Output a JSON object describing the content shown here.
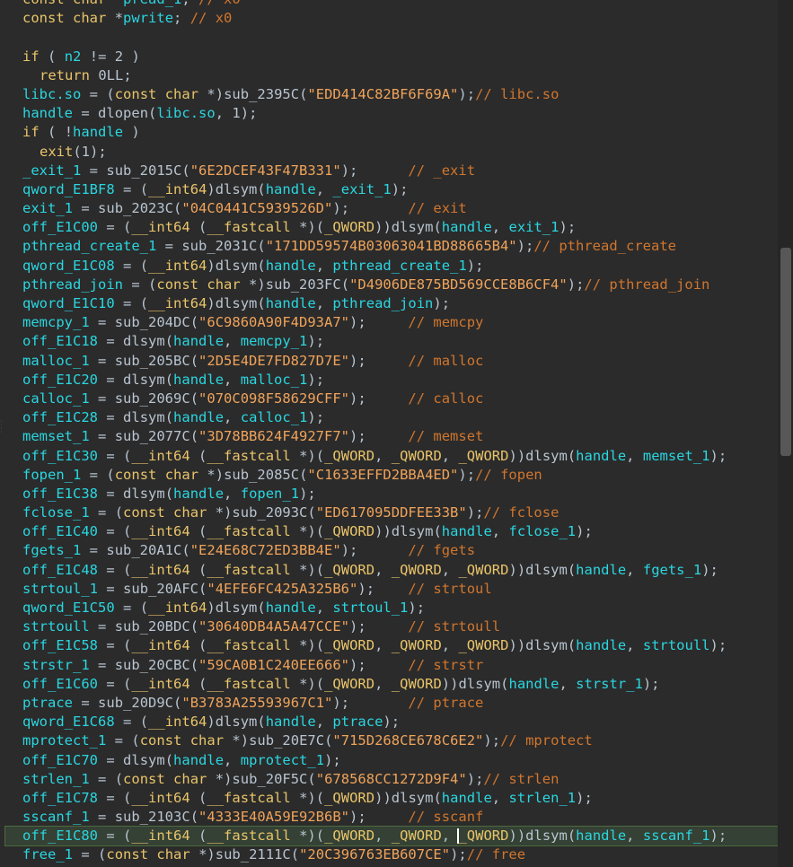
{
  "editor": {
    "lines": [
      "const char *pread_1; // x0",
      "const char *pwrite; // x0",
      "",
      "if ( n2 != 2 )",
      "  return 0LL;",
      "libc.so = (const char *)sub_2395C(\"EDD414C82BF6F69A\");// libc.so",
      "handle = dlopen(libc.so, 1);",
      "if ( !handle )",
      "  exit(1);",
      "_exit_1 = sub_2015C(\"6E2DCEF43F47B331\");      // _exit",
      "qword_E1BF8 = (__int64)dlsym(handle, _exit_1);",
      "exit_1 = sub_2023C(\"04C0441C5939526D\");       // exit",
      "off_E1C00 = (__int64 (__fastcall *)(_QWORD))dlsym(handle, exit_1);",
      "pthread_create_1 = sub_2031C(\"171DD59574B03063041BD88665B4\");// pthread_create",
      "qword_E1C08 = (__int64)dlsym(handle, pthread_create_1);",
      "pthread_join = (const char *)sub_203FC(\"D4906DE875BD569CCE8B6CF4\");// pthread_join",
      "qword_E1C10 = (__int64)dlsym(handle, pthread_join);",
      "memcpy_1 = sub_204DC(\"6C9860A90F4D93A7\");     // memcpy",
      "off_E1C18 = dlsym(handle, memcpy_1);",
      "malloc_1 = sub_205BC(\"2D5E4DE7FD827D7E\");     // malloc",
      "off_E1C20 = dlsym(handle, malloc_1);",
      "calloc_1 = sub_2069C(\"070C098F58629CFF\");     // calloc",
      "off_E1C28 = dlsym(handle, calloc_1);",
      "memset_1 = sub_2077C(\"3D78BB624F4927F7\");     // memset",
      "off_E1C30 = (__int64 (__fastcall *)(_QWORD, _QWORD, _QWORD))dlsym(handle, memset_1);",
      "fopen_1 = (const char *)sub_2085C(\"C1633EFFD2BBA4ED\");// fopen",
      "off_E1C38 = dlsym(handle, fopen_1);",
      "fclose_1 = (const char *)sub_2093C(\"ED617095DDFEE33B\");// fclose",
      "off_E1C40 = (__int64 (__fastcall *)(_QWORD))dlsym(handle, fclose_1);",
      "fgets_1 = sub_20A1C(\"E24E68C72ED3BB4E\");      // fgets",
      "off_E1C48 = (__int64 (__fastcall *)(_QWORD, _QWORD, _QWORD))dlsym(handle, fgets_1);",
      "strtoul_1 = sub_20AFC(\"4EFE6FC425A325B6\");    // strtoul",
      "qword_E1C50 = (__int64)dlsym(handle, strtoul_1);",
      "strtoull = sub_20BDC(\"30640DB4A5A47CCE\");     // strtoull",
      "off_E1C58 = (__int64 (__fastcall *)(_QWORD, _QWORD, _QWORD))dlsym(handle, strtoull);",
      "strstr_1 = sub_20CBC(\"59CA0B1C240EE666\");     // strstr",
      "off_E1C60 = (__int64 (__fastcall *)(_QWORD, _QWORD))dlsym(handle, strstr_1);",
      "ptrace = sub_20D9C(\"B3783A25593967C1\");       // ptrace",
      "qword_E1C68 = (__int64)dlsym(handle, ptrace);",
      "mprotect_1 = (const char *)sub_20E7C(\"715D268CE678C6E2\");// mprotect",
      "off_E1C70 = dlsym(handle, mprotect_1);",
      "strlen_1 = (const char *)sub_20F5C(\"678568CC1272D9F4\");// strlen",
      "off_E1C78 = (__int64 (__fastcall *)(_QWORD))dlsym(handle, strlen_1);",
      "sscanf_1 = sub_2103C(\"4333E40A59E92B6B\");     // sscanf",
      "off_E1C80 = (__int64 (__fastcall *)(_QWORD, _QWORD, _QWORD))dlsym(handle, sscanf_1);",
      "free_1 = (const char *)sub_2111C(\"20C396763EB607CE\");// free"
    ],
    "highlighted_line": 44,
    "caret_column": 52
  },
  "colors": {
    "background": "#2b2b2b",
    "identifier": "#2ad6e0",
    "keyword": "#e9c46a",
    "string": "#f0a35a",
    "comment": "#d0762e",
    "highlight": "#344134"
  }
}
